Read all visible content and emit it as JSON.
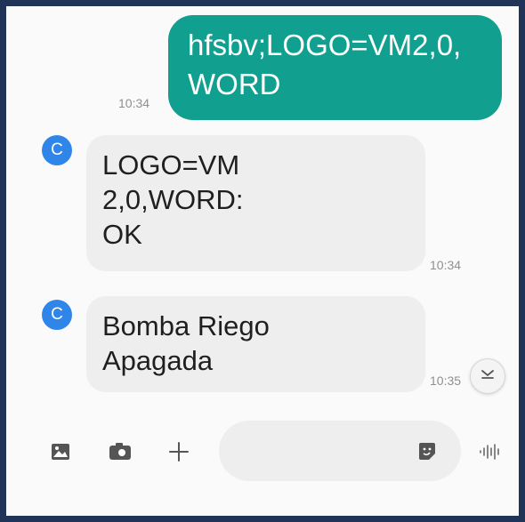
{
  "conversation": {
    "messages": [
      {
        "direction": "outgoing",
        "text_lines": [
          "hfsbv;LOGO=VM2,0,",
          "WORD"
        ],
        "time": "10:34"
      },
      {
        "direction": "incoming",
        "avatar": "C",
        "text_lines": [
          "LOGO=VM",
          "2,0,WORD:",
          "OK"
        ],
        "time": "10:34"
      },
      {
        "direction": "incoming",
        "avatar": "C",
        "text_lines": [
          "Bomba Riego",
          "Apagada"
        ],
        "time": "10:35"
      }
    ]
  },
  "composer": {
    "placeholder": "",
    "icons": [
      "gallery-icon",
      "camera-icon",
      "plus-icon",
      "sticker-icon",
      "voice-icon"
    ]
  },
  "colors": {
    "outgoing_bubble": "#11a08f",
    "incoming_bubble": "#eeeeee",
    "avatar": "#2f86e8",
    "frame": "#1f3457"
  }
}
